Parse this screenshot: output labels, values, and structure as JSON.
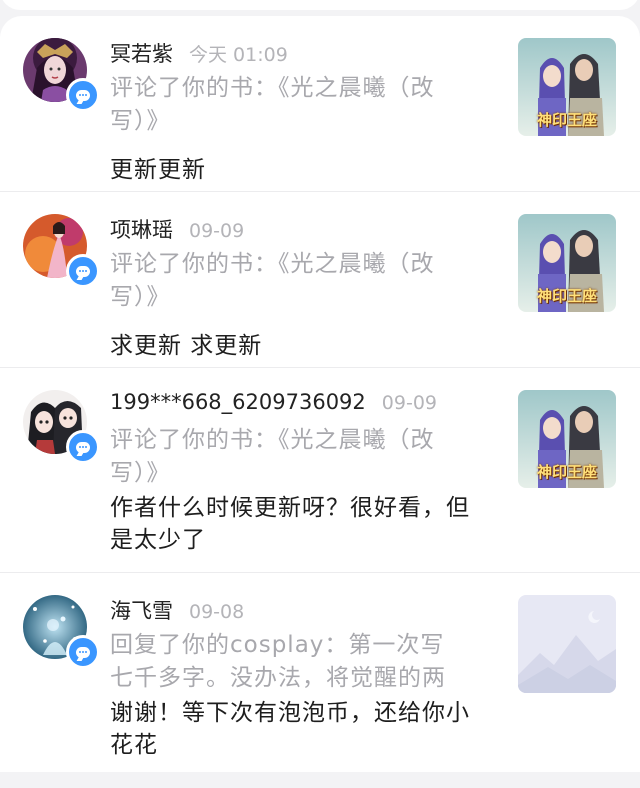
{
  "notifications": [
    {
      "user": "冥若紫",
      "time": "今天 01:09",
      "action": "评论了你的书：《光之晨曦（改写）》",
      "message": "更新更新",
      "avatar_icon": "avatar-purple-lady",
      "thumb_icon": "book-cover",
      "thumb_text": "神印王座"
    },
    {
      "user": "项琳瑶",
      "time": "09-09",
      "action": "评论了你的书：《光之晨曦（改写）》",
      "message": "求更新 求更新",
      "avatar_icon": "avatar-pink-girl",
      "thumb_icon": "book-cover",
      "thumb_text": "神印王座"
    },
    {
      "user": "199***668_6209736092",
      "time": "09-09",
      "action": "评论了你的书：《光之晨曦（改写）》",
      "message": "作者什么时候更新呀？很好看，但是太少了",
      "avatar_icon": "avatar-couple-cartoon",
      "thumb_icon": "book-cover",
      "thumb_text": "神印王座"
    },
    {
      "user": "海飞雪",
      "time": "09-08",
      "action": "回复了你的cosplay：第一次写七千多字。没办法，将觉醒的两集…",
      "message": "谢谢！等下次有泡泡币，还给你小花花",
      "avatar_icon": "avatar-snow-blue",
      "thumb_icon": "placeholder-mountain-icon",
      "thumb_text": ""
    }
  ]
}
